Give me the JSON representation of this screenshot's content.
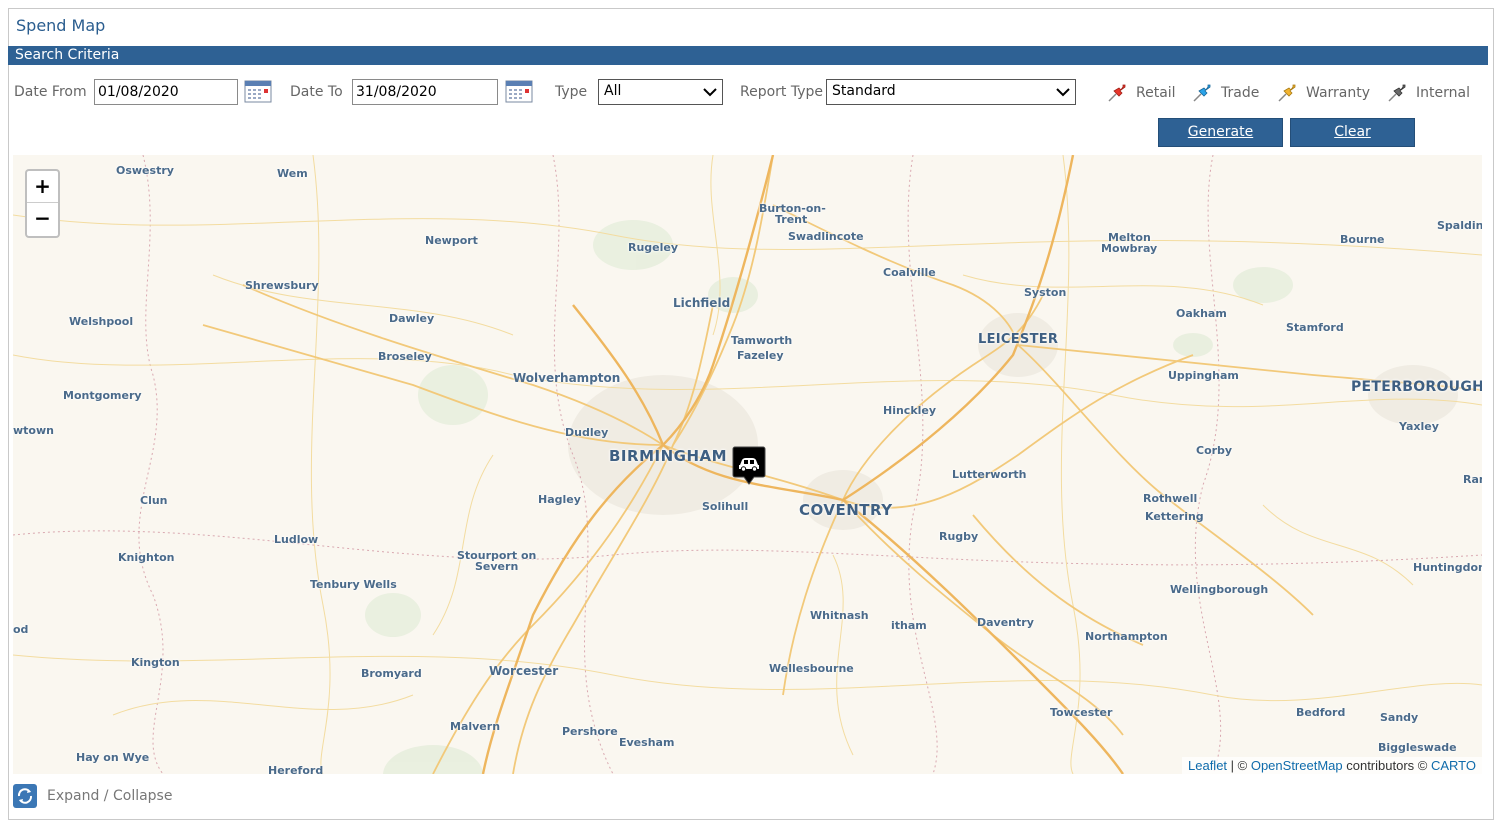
{
  "title": "Spend Map",
  "section": "Search Criteria",
  "filters": {
    "date_from_label": "Date From",
    "date_from_value": "01/08/2020",
    "date_to_label": "Date To",
    "date_to_value": "31/08/2020",
    "type_label": "Type",
    "type_value": "All",
    "report_type_label": "Report Type",
    "report_type_value": "Standard"
  },
  "legend": [
    {
      "label": "Retail",
      "color": "#e8352b",
      "icon": "pushpin-red-icon"
    },
    {
      "label": "Trade",
      "color": "#2aa3e8",
      "icon": "pushpin-blue-icon"
    },
    {
      "label": "Warranty",
      "color": "#f2b431",
      "icon": "pushpin-yellow-icon"
    },
    {
      "label": "Internal",
      "color": "#6a6a6a",
      "icon": "pushpin-grey-icon"
    }
  ],
  "buttons": {
    "generate": "Generate",
    "clear": "Clear"
  },
  "map": {
    "zoom_in": "+",
    "zoom_out": "−",
    "places": {
      "oswestry": "Oswestry",
      "wem": "Wem",
      "newport": "Newport",
      "rugeley": "Rugeley",
      "burton": "Burton-on-",
      "burton2": "Trent",
      "swadlincote": "Swadlincote",
      "melton": "Melton",
      "melton2": "Mowbray",
      "bourne": "Bourne",
      "spalding": "Spaldin",
      "shrewsbury": "Shrewsbury",
      "coalville": "Coalville",
      "lichfield": "Lichfield",
      "syston": "Syston",
      "welshpool": "Welshpool",
      "dawley": "Dawley",
      "tamworth": "Tamworth",
      "fazeley": "Fazeley",
      "leicester": "LEICESTER",
      "oakham": "Oakham",
      "stamford": "Stamford",
      "broseley": "Broseley",
      "wolverhampton": "Wolverhampton",
      "uppingham": "Uppingham",
      "peterborough": "PETERBOROUGH",
      "montgomery": "Montgomery",
      "hinckley": "Hinckley",
      "newtown": "wtown",
      "dudley": "Dudley",
      "yaxley": "Yaxley",
      "birmingham": "BIRMINGHAM",
      "corby": "Corby",
      "lutterworth": "Lutterworth",
      "ramsey": "Ran",
      "clun": "Clun",
      "hagley": "Hagley",
      "solihull": "Solihull",
      "coventry": "COVENTRY",
      "rothwell": "Rothwell",
      "kettering": "Kettering",
      "ludlow": "Ludlow",
      "rugby": "Rugby",
      "knighton": "Knighton",
      "stourport": "Stourport on",
      "stourport2": "Severn",
      "huntingdon": "Huntingdon",
      "tenbury": "Tenbury Wells",
      "wellingborough": "Wellingborough",
      "whitnash": "Whitnash",
      "southam": "itham",
      "daventry": "Daventry",
      "llandod": "od",
      "northampton": "Northampton",
      "kington": "Kington",
      "worcester": "Worcester",
      "bromyard": "Bromyard",
      "wellesbourne": "Wellesbourne",
      "malvern": "Malvern",
      "pershore": "Pershore",
      "towcester": "Towcester",
      "bedford": "Bedford",
      "sandy": "Sandy",
      "evesham": "Evesham",
      "hay": "Hay on Wye",
      "biggleswade": "Biggleswade",
      "hereford": "Hereford"
    },
    "attribution": {
      "leaflet": "Leaflet",
      "sep": " | © ",
      "osm": "OpenStreetMap",
      "contrib": " contributors © ",
      "carto": "CARTO"
    }
  },
  "expand_label": "Expand / Collapse"
}
